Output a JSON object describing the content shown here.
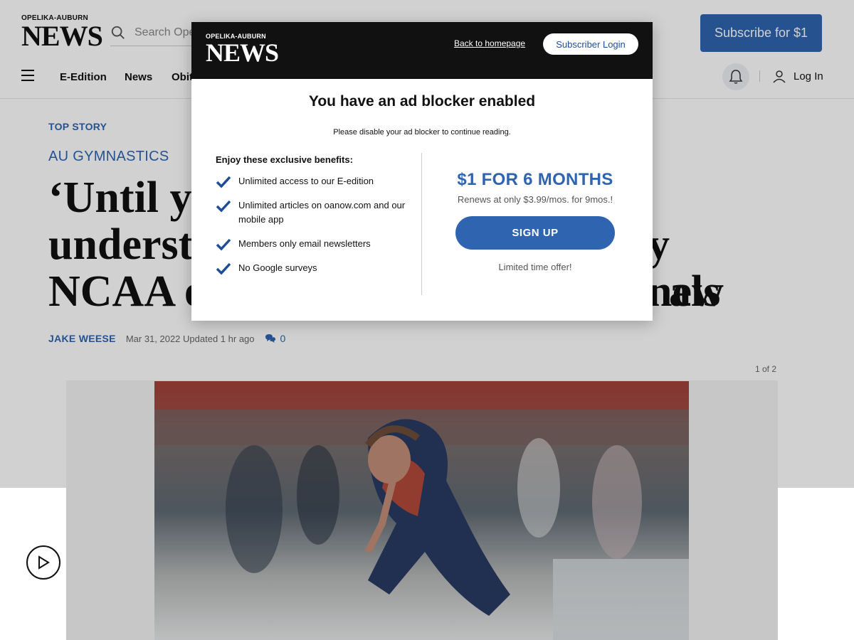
{
  "site": {
    "logo_top": "OPELIKA-AUBURN",
    "logo_main": "NEWS",
    "search_placeholder": "Search Opelika-Auburn News",
    "search_partial": "Search Ope",
    "subscribe_label": "Subscribe for $1"
  },
  "nav": {
    "items": [
      "E-Edition",
      "News",
      "Obit"
    ],
    "login_label": "Log In"
  },
  "article": {
    "top_story": "TOP STORY",
    "kicker": "AU GYMNASTICS",
    "headline_line1": "‘Until yo",
    "headline_line2": "understa",
    "headline_line2_right": "y new",
    "headline_line3": "NCAA ex",
    "headline_line3_right": "als",
    "author": "JAKE WEESE",
    "date": "Mar 31, 2022",
    "updated": "Updated 1 hr ago",
    "comments": "0",
    "gallery_count": "1 of 2"
  },
  "modal": {
    "logo_top": "OPELIKA-AUBURN",
    "logo_main": "NEWS",
    "back_link": "Back to homepage",
    "login_button": "Subscriber Login",
    "title": "You have an ad blocker enabled",
    "subtitle": "Please disable your ad blocker to continue reading.",
    "benefits_title": "Enjoy these exclusive benefits:",
    "benefits": [
      "Unlimited access to our E-edition",
      "Unlimited articles on oanow.com and our mobile app",
      "Members only email newsletters",
      "No Google surveys"
    ],
    "offer_price": "$1 FOR 6 MONTHS",
    "offer_renew": "Renews at only $3.99/mos. for 9mos.!",
    "signup_label": "SIGN UP",
    "limited": "Limited time offer!"
  },
  "colors": {
    "accent": "#2f64b0",
    "modal_header": "#111111"
  }
}
